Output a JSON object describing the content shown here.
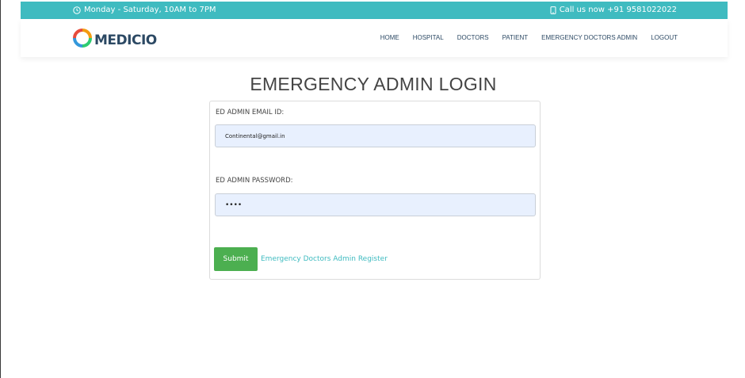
{
  "topbar": {
    "hours": "Monday - Saturday, 10AM to 7PM",
    "phone": "Call us now +91 9581022022",
    "icons": [
      "clock-icon",
      "phone-icon"
    ]
  },
  "brand": {
    "name": "MEDICIO",
    "icon": "ring-logo-icon"
  },
  "nav": {
    "items": [
      "HOME",
      "HOSPITAL",
      "DOCTORS",
      "PATIENT",
      "EMERGENCY DOCTORS ADMIN",
      "LOGOUT"
    ]
  },
  "page": {
    "title": "EMERGENCY ADMIN LOGIN"
  },
  "form": {
    "email_label": "ED ADMIN EMAIL ID:",
    "email_value": "Continental@gmail.in",
    "password_label": "ED ADMIN PASSWORD:",
    "password_value": "••••",
    "submit_label": "Submit",
    "register_link": "Emergency Doctors Admin Register"
  },
  "colors": {
    "accent": "#3fbbc0",
    "submit": "#4caf50",
    "input_fill": "#e8f0fe",
    "nav_text": "#2c4964"
  }
}
